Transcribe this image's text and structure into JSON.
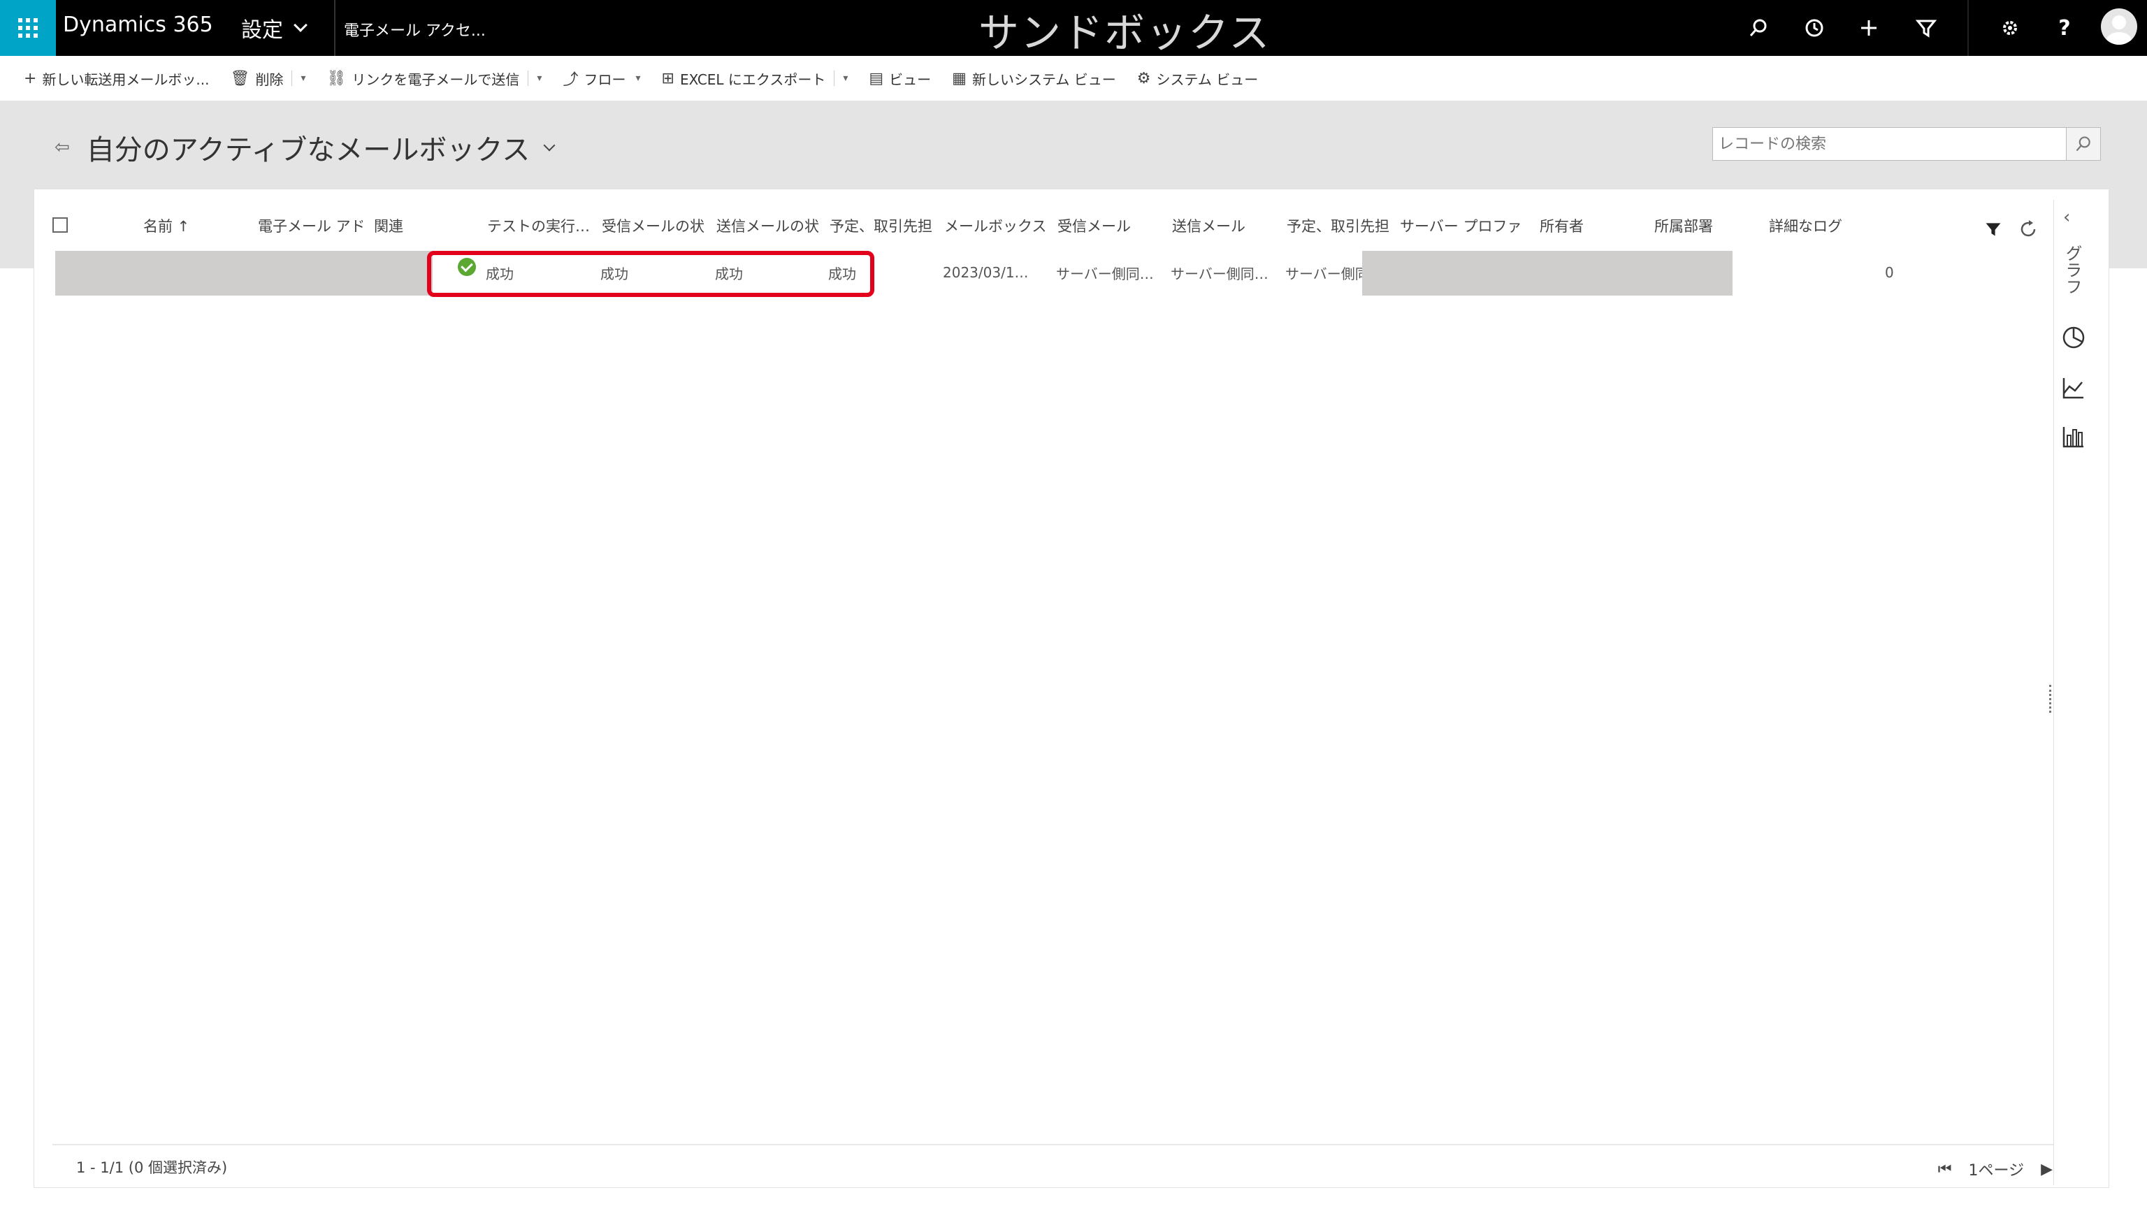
{
  "app": {
    "brand": "Dynamics 365",
    "area": "設定",
    "breadcrumb": "電子メール アクセ...",
    "environment": "サンドボックス"
  },
  "topbar_icons": [
    "search-icon",
    "history-icon",
    "plus-icon",
    "filter-icon",
    "gear-icon",
    "help-icon",
    "user-avatar"
  ],
  "toolbar": {
    "new_mailbox": "新しい転送用メールボッ...",
    "delete": "削除",
    "email_link": "リンクを電子メールで送信",
    "flow": "フロー",
    "excel": "EXCEL にエクスポート",
    "view": "ビュー",
    "new_system_view": "新しいシステム ビュー",
    "system_view": "システム ビュー"
  },
  "page": {
    "title": "自分のアクティブなメールボックス",
    "search_placeholder": "レコードの検索"
  },
  "grid": {
    "columns": [
      "名前 ↑",
      "電子メール アド",
      "関連",
      "テストの実行…",
      "受信メールの状",
      "送信メールの状",
      "予定、取引先担",
      "メールボックス",
      "受信メール",
      "送信メール",
      "予定、取引先担",
      "サーバー プロファ",
      "所有者",
      "所属部署",
      "詳細なログ"
    ],
    "row": {
      "test_run": "成功",
      "incoming_status": "成功",
      "outgoing_status": "成功",
      "appointments_status": "成功",
      "mailbox_date": "2023/03/1…",
      "incoming_mail": "サーバー側同…",
      "outgoing_mail": "サーバー側同…",
      "appointments_sync": "サーバー側同期",
      "detailed_log": "0"
    }
  },
  "footer": {
    "record_count": "1 - 1/1 (0 個選択済み)",
    "page_label": "1ページ"
  },
  "side_panel": {
    "label": "グラフ"
  },
  "colors": {
    "waffle": "#00a4c6",
    "highlight": "#e3001b",
    "success": "#5aa832"
  }
}
